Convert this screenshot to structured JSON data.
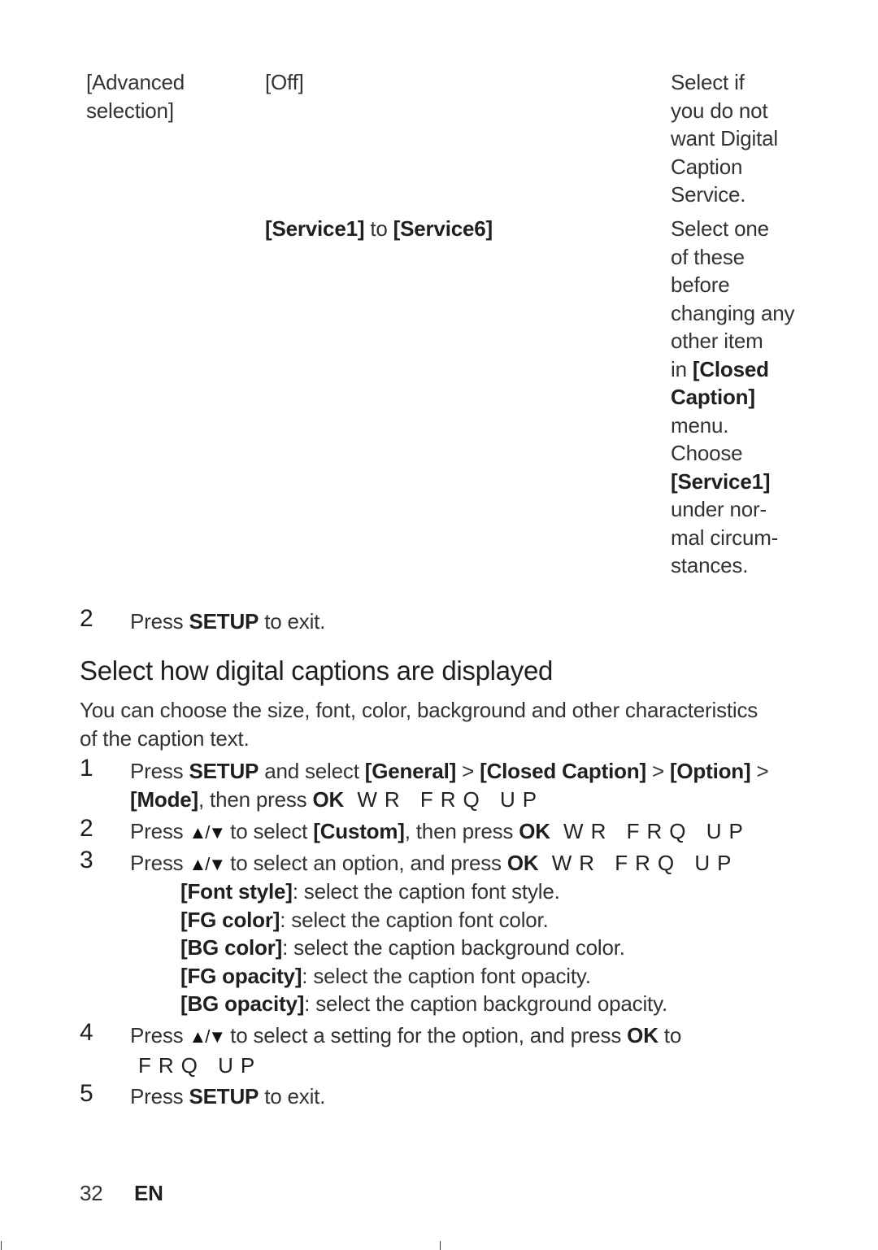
{
  "table": {
    "setting_label_line1": "[Advanced",
    "setting_label_line2": "selection]",
    "rows": [
      {
        "option": "[Off]",
        "description_lines": [
          "Select if",
          "you do not",
          "want Digital",
          "Caption",
          "Service."
        ]
      },
      {
        "option_start": "[Service1]",
        "option_connector": " to ",
        "option_end": "[Service6]",
        "description_lines": [
          "Select one",
          "of these",
          "before",
          "changing any",
          "other item"
        ],
        "description_in": "in ",
        "description_closed": "[Closed",
        "description_caption": "Caption]",
        "description_menu": "menu.",
        "description_choose": "Choose",
        "description_service1": "[Service1]",
        "description_tail": [
          "under nor-",
          "mal circum-",
          "stances."
        ]
      }
    ]
  },
  "step_exit_top": {
    "number": "2",
    "press": "Press ",
    "key": "SETUP",
    "rest": " to exit."
  },
  "section": {
    "heading": "Select how digital captions are displayed",
    "intro_line1": "You can choose the size, font, color, background and other characteristics",
    "intro_line2": "of the caption text."
  },
  "steps": {
    "s1": {
      "number": "1",
      "press": "Press ",
      "key": "SETUP",
      "and_select": " and select ",
      "general": "[General]",
      "sep": " > ",
      "closed_caption": "[Closed Caption]",
      "option": "[Option]",
      "mode": "[Mode]",
      "then_press": ", then press ",
      "ok": "OK",
      "garbled": " WR FRQ UP"
    },
    "s2": {
      "number": "2",
      "press": "Press ",
      "arrows": "▲/▼",
      "to_select": " to select ",
      "custom": "[Custom]",
      "then_press": ", then press ",
      "ok": "OK",
      "garbled": " WR FRQ UP"
    },
    "s3": {
      "number": "3",
      "press": "Press ",
      "arrows": "▲/▼",
      "to_select": " to select an option, and press ",
      "ok": "OK",
      "garbled": " WR FRQ UP",
      "options": [
        {
          "name": "[Font style]",
          "desc": ": select the caption font style."
        },
        {
          "name": "[FG color]",
          "desc": ": select the caption font color."
        },
        {
          "name": "[BG color]",
          "desc": ": select the caption background color."
        },
        {
          "name": "[FG opacity]",
          "desc": ": select the caption font opacity."
        },
        {
          "name": "[BG opacity]",
          "desc": ": select the caption background opacity."
        }
      ]
    },
    "s4": {
      "number": "4",
      "press": "Press ",
      "arrows": "▲/▼",
      "to_select": " to select a setting for the option, and press ",
      "ok": "OK",
      "to": " to",
      "garbled": "FRQ UP"
    },
    "s5": {
      "number": "5",
      "press": "Press ",
      "key": "SETUP",
      "rest": " to exit."
    }
  },
  "footer": {
    "page_number": "32",
    "language": "EN"
  }
}
